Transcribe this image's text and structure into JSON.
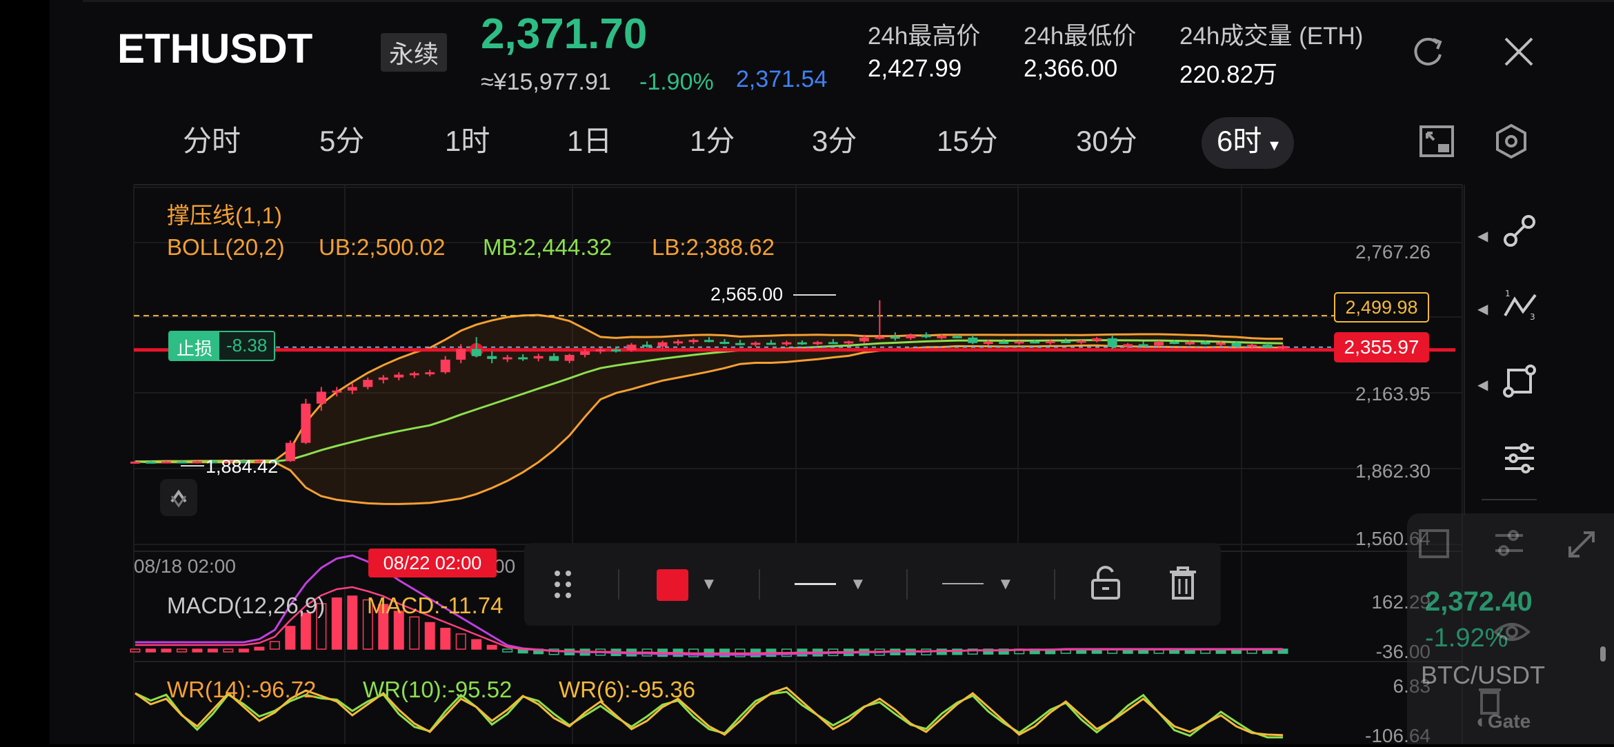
{
  "header": {
    "symbol": "ETHUSDT",
    "contract_type": "永续",
    "last_price": "2,371.70",
    "cny_price": "≈¥15,977.91",
    "change_pct": "-1.90%",
    "mark_price": "2,371.54",
    "stats": [
      {
        "label": "24h最高价",
        "value": "2,427.99"
      },
      {
        "label": "24h最低价",
        "value": "2,366.00"
      },
      {
        "label": "24h成交量 (ETH)",
        "value": "220.82万"
      }
    ]
  },
  "tabs": [
    "分时",
    "5分",
    "1时",
    "1日",
    "1分",
    "3分",
    "15分",
    "30分",
    "6时"
  ],
  "active_tab": "6时",
  "indicators": {
    "support_line": "撑压线(1,1)",
    "boll": {
      "name": "BOLL(20,2)",
      "ub": "UB:2,500.02",
      "mb": "MB:2,444.32",
      "lb": "LB:2,388.62"
    },
    "stop_loss": {
      "label": "止损",
      "value": "-8.38"
    },
    "high_label": "2,565.00",
    "low_label": "1,884.42",
    "price_tag_upper": "2,499.98",
    "price_tag_lower": "2,355.97",
    "crosshair_time": "08/22 02:00",
    "macd": {
      "name": "MACD(12,26,9)",
      "value": "MACD:-11.74"
    },
    "wr": {
      "wr14": "WR(14):-96.72",
      "wr10": "WR(10):-95.52",
      "wr6": "WR(6):-95.36"
    }
  },
  "chart_data": {
    "type": "candlestick",
    "y_ticks": [
      "2,767.26",
      "2,163.95",
      "1,862.30",
      "1,560.64"
    ],
    "ylim": [
      1560.64,
      2767.26
    ],
    "x_ticks": [
      "08/18 02:00",
      "00"
    ],
    "macd_ticks": [
      "162.29",
      "-36.00"
    ],
    "wr_ticks": [
      "6.83",
      "-106.64"
    ],
    "candles": [
      [
        1884,
        1890,
        1878,
        1886
      ],
      [
        1886,
        1892,
        1880,
        1884
      ],
      [
        1884,
        1889,
        1879,
        1887
      ],
      [
        1887,
        1893,
        1882,
        1885
      ],
      [
        1885,
        1890,
        1878,
        1888
      ],
      [
        1888,
        1894,
        1883,
        1886
      ],
      [
        1886,
        1892,
        1880,
        1889
      ],
      [
        1889,
        1896,
        1884,
        1887
      ],
      [
        1887,
        1893,
        1881,
        1890
      ],
      [
        1890,
        1898,
        1885,
        1888
      ],
      [
        1888,
        1975,
        1885,
        1965
      ],
      [
        1965,
        2150,
        1960,
        2130
      ],
      [
        2130,
        2200,
        2100,
        2180
      ],
      [
        2180,
        2200,
        2160,
        2185
      ],
      [
        2185,
        2215,
        2170,
        2200
      ],
      [
        2200,
        2240,
        2190,
        2230
      ],
      [
        2230,
        2250,
        2215,
        2240
      ],
      [
        2240,
        2262,
        2228,
        2252
      ],
      [
        2252,
        2265,
        2238,
        2258
      ],
      [
        2258,
        2272,
        2245,
        2262
      ],
      [
        2262,
        2330,
        2255,
        2315
      ],
      [
        2315,
        2380,
        2300,
        2360
      ],
      [
        2360,
        2410,
        2325,
        2330
      ],
      [
        2330,
        2350,
        2300,
        2318
      ],
      [
        2318,
        2335,
        2305,
        2325
      ],
      [
        2325,
        2338,
        2310,
        2320
      ],
      [
        2320,
        2340,
        2308,
        2330
      ],
      [
        2330,
        2342,
        2320,
        2310
      ],
      [
        2310,
        2340,
        2300,
        2335
      ],
      [
        2335,
        2360,
        2325,
        2350
      ],
      [
        2350,
        2365,
        2340,
        2358
      ],
      [
        2358,
        2370,
        2345,
        2355
      ],
      [
        2355,
        2385,
        2348,
        2378
      ],
      [
        2378,
        2392,
        2365,
        2370
      ],
      [
        2370,
        2395,
        2360,
        2388
      ],
      [
        2388,
        2400,
        2375,
        2392
      ],
      [
        2392,
        2405,
        2380,
        2398
      ],
      [
        2398,
        2410,
        2388,
        2390
      ],
      [
        2390,
        2402,
        2380,
        2385
      ],
      [
        2385,
        2398,
        2375,
        2380
      ],
      [
        2380,
        2392,
        2370,
        2386
      ],
      [
        2386,
        2398,
        2378,
        2381
      ],
      [
        2381,
        2395,
        2372,
        2388
      ],
      [
        2388,
        2396,
        2377,
        2383
      ],
      [
        2383,
        2394,
        2375,
        2389
      ],
      [
        2389,
        2402,
        2380,
        2385
      ],
      [
        2385,
        2395,
        2376,
        2392
      ],
      [
        2392,
        2420,
        2385,
        2408
      ],
      [
        2408,
        2565,
        2400,
        2412
      ],
      [
        2412,
        2430,
        2395,
        2405
      ],
      [
        2405,
        2425,
        2398,
        2418
      ],
      [
        2418,
        2430,
        2405,
        2410
      ],
      [
        2410,
        2422,
        2400,
        2414
      ],
      [
        2414,
        2425,
        2405,
        2408
      ],
      [
        2408,
        2420,
        2380,
        2385
      ],
      [
        2385,
        2398,
        2375,
        2390
      ],
      [
        2390,
        2402,
        2382,
        2386
      ],
      [
        2386,
        2395,
        2378,
        2392
      ],
      [
        2392,
        2400,
        2383,
        2387
      ],
      [
        2387,
        2398,
        2378,
        2393
      ],
      [
        2393,
        2405,
        2385,
        2389
      ],
      [
        2389,
        2398,
        2380,
        2395
      ],
      [
        2395,
        2410,
        2388,
        2405
      ],
      [
        2405,
        2420,
        2360,
        2370
      ],
      [
        2370,
        2385,
        2362,
        2380
      ],
      [
        2380,
        2392,
        2372,
        2375
      ],
      [
        2375,
        2395,
        2370,
        2390
      ],
      [
        2390,
        2398,
        2380,
        2384
      ],
      [
        2384,
        2395,
        2376,
        2388
      ],
      [
        2388,
        2396,
        2378,
        2382
      ],
      [
        2382,
        2392,
        2372,
        2386
      ],
      [
        2386,
        2394,
        2368,
        2370
      ],
      [
        2370,
        2382,
        2360,
        2378
      ],
      [
        2378,
        2385,
        2362,
        2366
      ],
      [
        2366,
        2378,
        2358,
        2372
      ]
    ],
    "macd_hist": [
      0,
      0,
      0,
      0,
      0,
      0,
      0,
      0,
      5,
      20,
      60,
      95,
      120,
      135,
      140,
      130,
      118,
      100,
      85,
      70,
      55,
      40,
      25,
      10,
      -5,
      -10,
      -12,
      -14,
      -15,
      -16,
      -16,
      -17,
      -18,
      -18,
      -19,
      -19,
      -20,
      -20,
      -20,
      -20,
      -20,
      -19,
      -19,
      -18,
      -18,
      -17,
      -17,
      -16,
      -16,
      -15,
      -15,
      -15,
      -14,
      -14,
      -13,
      -13,
      -13,
      -12,
      -12,
      -12,
      -11,
      -11,
      -11,
      -11,
      -11,
      -11,
      -11,
      -11,
      -11,
      -11,
      -11,
      -11,
      -11,
      -11,
      -11
    ],
    "wr": [
      -20,
      -40,
      -30,
      -60,
      -80,
      -50,
      -20,
      -45,
      -70,
      -55,
      -30,
      -15,
      -25,
      -35,
      -60,
      -40,
      -20,
      -50,
      -75,
      -90,
      -60,
      -30,
      -45,
      -70,
      -50,
      -25,
      -40,
      -65,
      -80,
      -55,
      -35,
      -60,
      -85,
      -70,
      -45,
      -30,
      -55,
      -80,
      -95,
      -70,
      -40,
      -20,
      -10,
      -35,
      -60,
      -85,
      -70,
      -45,
      -30,
      -50,
      -75,
      -90,
      -65,
      -40,
      -20,
      -45,
      -70,
      -95,
      -80,
      -55,
      -35,
      -60,
      -85,
      -70,
      -50,
      -30,
      -55,
      -80,
      -90,
      -75,
      -60,
      -80,
      -92,
      -95,
      -96
    ]
  },
  "right_card": {
    "price": "2,372.40",
    "change": "-1.92%",
    "pair": "BTC/USDT",
    "brand": "Gate"
  },
  "colors": {
    "up": "#ff3b5c",
    "down": "#2ebd85",
    "ub": "#f5a033",
    "mb": "#8be04e",
    "bg": "#0b0b0d"
  }
}
